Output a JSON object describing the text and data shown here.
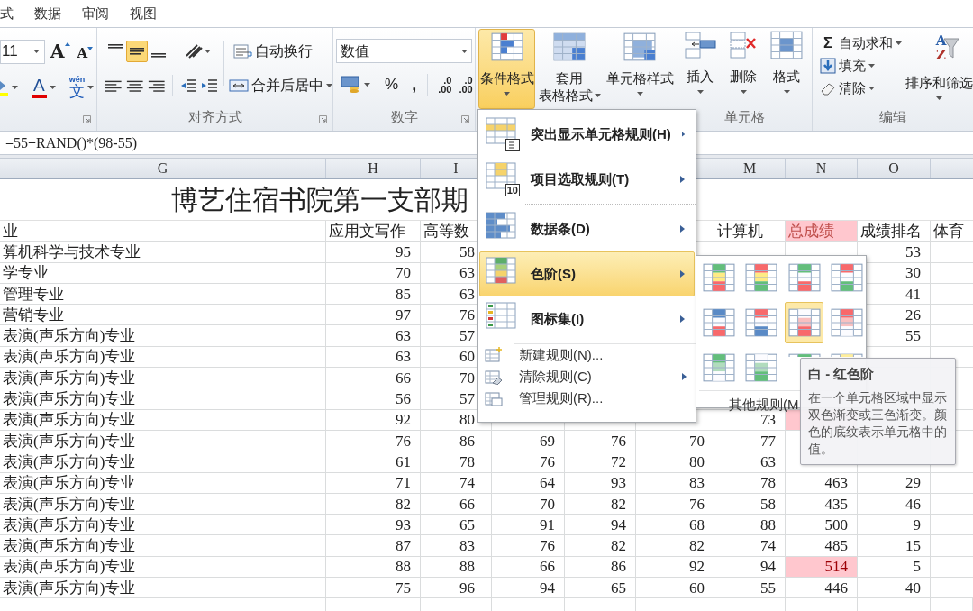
{
  "menu_tabs": [
    {
      "label": "式"
    },
    {
      "label": "数据"
    },
    {
      "label": "审阅"
    },
    {
      "label": "视图"
    }
  ],
  "ribbon": {
    "font": {
      "size": "11",
      "grow_glyph": "A",
      "shrink_glyph": "A",
      "color_glyph": "A",
      "phonetic_ruby": "wén",
      "phonetic_glyph": "文"
    },
    "alignment": {
      "label": "对齐方式",
      "wrap_text": "自动换行",
      "merge_center": "合并后居中",
      "vertical_align": [
        {
          "selected": false
        },
        {
          "selected": true
        },
        {
          "selected": false
        }
      ]
    },
    "number": {
      "label": "数字",
      "format": "数值",
      "percent": "%",
      "comma": ",",
      "decimal_buttons": [
        {
          "top": ".0",
          "bottom": ".00"
        },
        {
          "top": ".0",
          "bottom": ".00"
        }
      ]
    },
    "styles": {
      "buttons": [
        {
          "kind": "conditional",
          "lines": [
            "条件格式"
          ],
          "selected": true
        },
        {
          "kind": "table",
          "lines": [
            "套用",
            "表格格式"
          ],
          "selected": false
        },
        {
          "kind": "cell",
          "lines": [
            "单元格样式"
          ],
          "selected": false
        }
      ]
    },
    "cells": {
      "label": "单元格",
      "buttons": [
        {
          "kind": "insert",
          "label": "插入"
        },
        {
          "kind": "delete",
          "label": "删除"
        },
        {
          "kind": "format",
          "label": "格式"
        }
      ]
    },
    "editing": {
      "label": "编辑",
      "items": [
        {
          "kind": "sum",
          "glyph": "Σ",
          "label": "自动求和"
        },
        {
          "kind": "fill",
          "label": "填充"
        },
        {
          "kind": "clear",
          "label": "清除"
        }
      ],
      "sort": {
        "label": "排序和筛选",
        "glyphs": [
          "A",
          "Z"
        ]
      }
    }
  },
  "formula_bar": {
    "formula": "=55+RAND()*(98-55)"
  },
  "sheet": {
    "column_headers_left": [
      "G",
      "H",
      "I"
    ],
    "column_headers_right": [
      "M",
      "N",
      "O"
    ],
    "title": "博艺住宿书院第一支部期",
    "header_row": {
      "cells": [
        "业",
        "应用文写作",
        "高等数",
        null,
        null,
        null,
        "计算机",
        "总成绩",
        "成绩排名",
        "体育"
      ],
      "total_highlighted": true
    },
    "rows": [
      {
        "cells": [
          "算机科学与技术专业",
          "95",
          "58",
          null,
          null,
          null,
          null,
          null,
          "53",
          null
        ],
        "total_highlighted": false
      },
      {
        "cells": [
          "学专业",
          "70",
          "63",
          null,
          null,
          null,
          null,
          null,
          "30",
          null
        ]
      },
      {
        "cells": [
          "管理专业",
          "85",
          "63",
          null,
          null,
          null,
          null,
          null,
          "41",
          null
        ]
      },
      {
        "cells": [
          "营销专业",
          "97",
          "76",
          null,
          null,
          null,
          null,
          null,
          "26",
          null
        ]
      },
      {
        "cells": [
          "表演(声乐方向)专业",
          "63",
          "57",
          null,
          null,
          null,
          null,
          null,
          "55",
          null
        ]
      },
      {
        "cells": [
          "表演(声乐方向)专业",
          "63",
          "60",
          null,
          null,
          null,
          null,
          null,
          null,
          null
        ]
      },
      {
        "cells": [
          "表演(声乐方向)专业",
          "66",
          "70",
          null,
          null,
          null,
          null,
          null,
          null,
          null
        ]
      },
      {
        "cells": [
          "表演(声乐方向)专业",
          "56",
          "57",
          null,
          null,
          null,
          null,
          null,
          null,
          null
        ]
      },
      {
        "cells": [
          "表演(声乐方向)专业",
          "92",
          "80",
          null,
          null,
          null,
          "73",
          null,
          null,
          null
        ],
        "total_highlighted": true
      },
      {
        "cells": [
          "表演(声乐方向)专业",
          "76",
          "86",
          "69",
          "76",
          "70",
          "77",
          null,
          null,
          null
        ],
        "total_highlighted": false
      },
      {
        "cells": [
          "表演(声乐方向)专业",
          "61",
          "78",
          "76",
          "72",
          "80",
          "63",
          null,
          null,
          null
        ],
        "total_highlighted": false
      },
      {
        "cells": [
          "表演(声乐方向)专业",
          "71",
          "74",
          "64",
          "93",
          "83",
          "78",
          "463",
          "29",
          null
        ],
        "total_highlighted": false
      },
      {
        "cells": [
          "表演(声乐方向)专业",
          "82",
          "66",
          "70",
          "82",
          "76",
          "58",
          "435",
          "46",
          null
        ],
        "total_highlighted": false
      },
      {
        "cells": [
          "表演(声乐方向)专业",
          "93",
          "65",
          "91",
          "94",
          "68",
          "88",
          "500",
          "9",
          null
        ],
        "total_highlighted": false
      },
      {
        "cells": [
          "表演(声乐方向)专业",
          "87",
          "83",
          "76",
          "82",
          "82",
          "74",
          "485",
          "15",
          null
        ],
        "total_highlighted": false
      },
      {
        "cells": [
          "表演(声乐方向)专业",
          "88",
          "88",
          "66",
          "86",
          "92",
          "94",
          "514",
          "5",
          null
        ],
        "total_highlighted": true
      },
      {
        "cells": [
          "表演(声乐方向)专业",
          "75",
          "96",
          "94",
          "65",
          "60",
          "55",
          "446",
          "40",
          null
        ],
        "total_highlighted": false
      }
    ]
  },
  "conditional_menu": {
    "items": [
      {
        "kind": "highlight",
        "label": "突出显示单元格规则(H)",
        "submenu": true,
        "selected": false
      },
      {
        "kind": "topbottom",
        "label": "项目选取规则(T)",
        "badge": "10",
        "submenu": true,
        "selected": false
      },
      {
        "kind": "databar",
        "label": "数据条(D)",
        "submenu": true,
        "selected": false
      },
      {
        "kind": "colorscale",
        "label": "色阶(S)",
        "submenu": true,
        "selected": true
      },
      {
        "kind": "iconset",
        "label": "图标集(I)",
        "submenu": true,
        "selected": false
      }
    ],
    "actions": [
      {
        "kind": "new",
        "label": "新建规则(N)...",
        "submenu": false
      },
      {
        "kind": "clear",
        "label": "清除规则(C)",
        "submenu": true
      },
      {
        "kind": "manage",
        "label": "管理规则(R)...",
        "submenu": false
      }
    ]
  },
  "color_scales": {
    "swatches": [
      {
        "selected": false
      },
      {
        "selected": false
      },
      {
        "selected": false
      },
      {
        "selected": false
      },
      {
        "selected": false
      },
      {
        "selected": false
      },
      {
        "selected": true
      },
      {
        "selected": false
      },
      {
        "selected": false
      },
      {
        "selected": false
      },
      {
        "selected": false
      },
      {
        "selected": false
      }
    ],
    "more": "其他规则(M"
  },
  "tooltip": {
    "title": "白 - 红色阶",
    "text": "在一个单元格区域中显示双色渐变或三色渐变。颜色的底纹表示单元格中的值。"
  }
}
